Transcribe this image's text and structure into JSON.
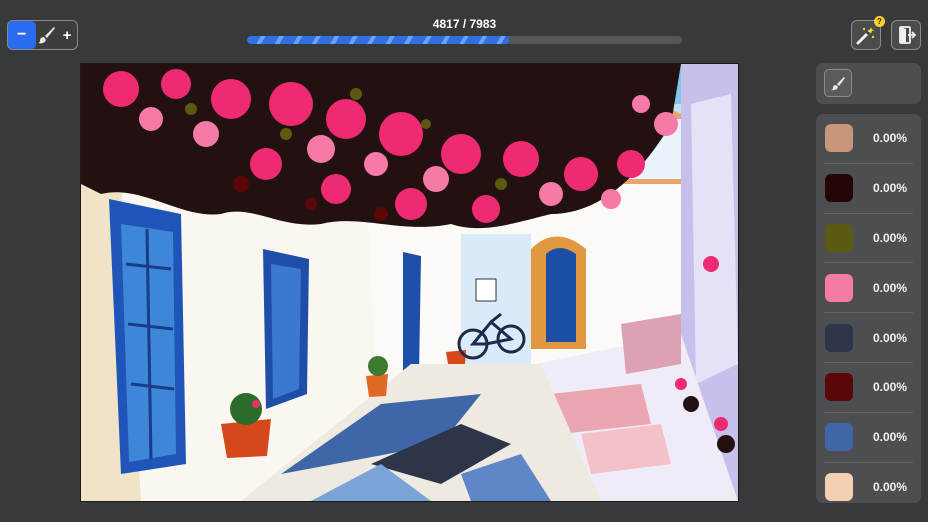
{
  "brush": {
    "minus_label": "−",
    "plus_label": "+",
    "icon": "paintbrush-icon"
  },
  "progress": {
    "label": "4817 / 7983",
    "fraction": 0.603
  },
  "toolbar": {
    "hint_icon": "magic-wand-icon",
    "hint_badge": "?",
    "exit_icon": "exit-door-icon"
  },
  "eraser": {
    "icon": "eraser-icon"
  },
  "palette": [
    {
      "color": "#c8967a",
      "percent": "0.00%"
    },
    {
      "color": "#250607",
      "percent": "0.00%"
    },
    {
      "color": "#5a5a10",
      "percent": "0.00%"
    },
    {
      "color": "#f57aa8",
      "percent": "0.00%"
    },
    {
      "color": "#2d3648",
      "percent": "0.00%"
    },
    {
      "color": "#5a0707",
      "percent": "0.00%"
    },
    {
      "color": "#3f66a6",
      "percent": "0.00%"
    },
    {
      "color": "#f3d0b4",
      "percent": "0.00%"
    }
  ],
  "artwork": {
    "subject": "whitewashed alley with blue doors and pink bougainvillea"
  }
}
